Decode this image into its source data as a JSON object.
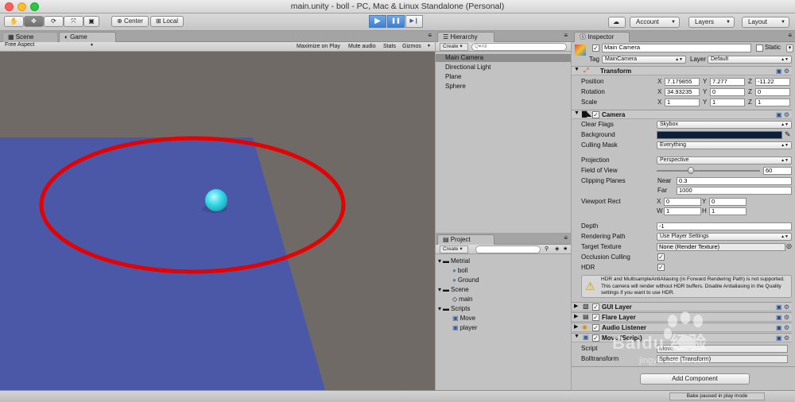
{
  "window": {
    "title": "main.unity - boll - PC, Mac & Linux Standalone (Personal)"
  },
  "toolbar": {
    "tools": [
      "✋",
      "✥",
      "⟳",
      "⤧",
      "▣"
    ],
    "center_label": "Center",
    "local_label": "Local",
    "play": "▶",
    "pause": "❚❚",
    "step": "▶❙",
    "cloud": "☁",
    "account_label": "Account",
    "layers_label": "Layers",
    "layout_label": "Layout"
  },
  "scene_view": {
    "tab_scene": "Scene",
    "tab_game": "Game",
    "aspect": "Free Aspect",
    "options": [
      "Maximize on Play",
      "Mute audio",
      "Stats",
      "Gizmos"
    ]
  },
  "hierarchy": {
    "tab": "Hierarchy",
    "create": "Create",
    "search_placeholder": "Q▾All",
    "items": [
      "Main Camera",
      "Directional Light",
      "Plane",
      "Sphere"
    ]
  },
  "project": {
    "tab": "Project",
    "create": "Create",
    "tree": [
      {
        "label": "Metrial",
        "level": 0,
        "icon": "folder-icon"
      },
      {
        "label": "boll",
        "level": 1,
        "icon": "material-icon"
      },
      {
        "label": "Ground",
        "level": 1,
        "icon": "material-icon"
      },
      {
        "label": "Scene",
        "level": 0,
        "icon": "folder-icon"
      },
      {
        "label": "main",
        "level": 1,
        "icon": "unity-scene-icon"
      },
      {
        "label": "Scripts",
        "level": 0,
        "icon": "folder-icon"
      },
      {
        "label": "Move",
        "level": 1,
        "icon": "script-icon"
      },
      {
        "label": "player",
        "level": 1,
        "icon": "script-icon"
      }
    ]
  },
  "inspector": {
    "tab": "Inspector",
    "object_name": "Main Camera",
    "static_label": "Static",
    "tag_label": "Tag",
    "tag_value": "MainCamera",
    "layer_label": "Layer",
    "layer_value": "Default",
    "transform": {
      "title": "Transform",
      "position": {
        "label": "Position",
        "x": "7.179855",
        "y": "7.277",
        "z": "-11.22"
      },
      "rotation": {
        "label": "Rotation",
        "x": "34.93235",
        "y": "0",
        "z": "0"
      },
      "scale": {
        "label": "Scale",
        "x": "1",
        "y": "1",
        "z": "1"
      }
    },
    "camera": {
      "title": "Camera",
      "clear_flags": {
        "label": "Clear Flags",
        "value": "Skybox"
      },
      "background": {
        "label": "Background"
      },
      "culling_mask": {
        "label": "Culling Mask",
        "value": "Everything"
      },
      "projection": {
        "label": "Projection",
        "value": "Perspective"
      },
      "fov": {
        "label": "Field of View",
        "value": "60",
        "fraction": 0.33
      },
      "clipping": {
        "label": "Clipping Planes",
        "near_label": "Near",
        "near": "0.3",
        "far_label": "Far",
        "far": "1000"
      },
      "viewport": {
        "label": "Viewport Rect",
        "x": "0",
        "y": "0",
        "w": "1",
        "h": "1"
      },
      "depth": {
        "label": "Depth",
        "value": "-1"
      },
      "rendering_path": {
        "label": "Rendering Path",
        "value": "Use Player Settings"
      },
      "target_texture": {
        "label": "Target Texture",
        "value": "None (Render Texture)"
      },
      "occlusion": {
        "label": "Occlusion Culling"
      },
      "hdr": {
        "label": "HDR"
      },
      "warning": "HDR and MultisampleAntiAliasing (in Forward Rendering Path) is not supported. This camera will render without HDR buffers. Disable Antialiasing in the Quality settings if you want to use HDR."
    },
    "components": [
      "GUI Layer",
      "Flare Layer",
      "Audio Listener",
      "Move (Script)"
    ],
    "move_script": {
      "script_label": "Script",
      "script_value": "Move",
      "boll_label": "Bolltransform",
      "boll_value": "Sphere (Transform)"
    },
    "add_component": "Add Component"
  },
  "status": {
    "text": "Bake paused in play mode"
  },
  "watermark": {
    "text": "Baidu 经验",
    "url": "jingyan.baidu.com"
  },
  "colors": {
    "play_blue": "#3b7fd1",
    "plane": "#4b58a8",
    "ground": "#6f6a66",
    "sphere": "#35d9e8",
    "annotation": "#e60000",
    "background_swatch": "#0b1f3a"
  }
}
